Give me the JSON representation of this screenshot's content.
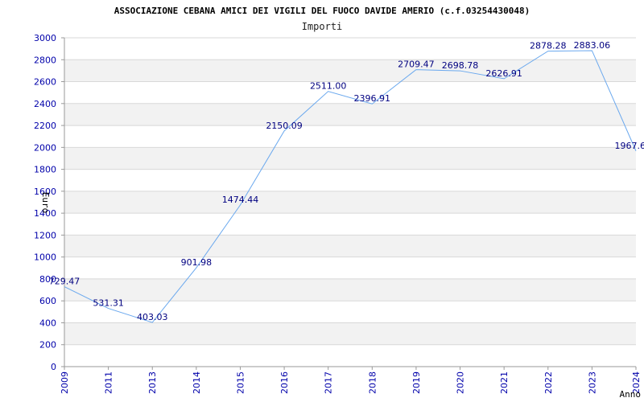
{
  "chart_data": {
    "type": "line",
    "title": "ASSOCIAZIONE CEBANA AMICI DEI VIGILI DEL FUOCO DAVIDE AMERIO (c.f.03254430048)",
    "subtitle": "Importi",
    "xlabel": "Anno",
    "ylabel": "Euro",
    "ylim": [
      0,
      3000
    ],
    "ytick_step": 200,
    "grid": true,
    "categories": [
      "2009",
      "2011",
      "2013",
      "2014",
      "2015",
      "2016",
      "2017",
      "2018",
      "2019",
      "2020",
      "2021",
      "2022",
      "2023",
      "2024"
    ],
    "value_labels": [
      "729.47",
      "531.31",
      "403.03",
      "901.98",
      "1474.44",
      "2150.09",
      "2511.00",
      "2396.91",
      "2709.47",
      "2698.78",
      "2626.91",
      "2878.28",
      "2883.06",
      "1967.6"
    ],
    "series": [
      {
        "values": [
          729.47,
          531.31,
          403.03,
          901.98,
          1474.44,
          2150.09,
          2511.0,
          2396.91,
          2709.47,
          2698.78,
          2626.91,
          2878.28,
          2883.06,
          1967.6
        ]
      }
    ],
    "colors": {
      "line": "#6aa8ee",
      "tick_text": "#0000aa",
      "value_text": "#000080",
      "band": "#f2f2f2",
      "grid": "#d8d8d8"
    }
  }
}
